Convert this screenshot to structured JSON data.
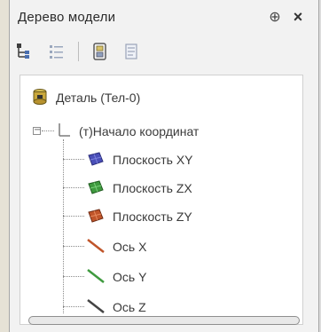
{
  "panel": {
    "title": "Дерево модели",
    "pin_glyph": "⊕",
    "close_glyph": "×"
  },
  "toolbar": {
    "buttons": [
      {
        "name": "build-tree-icon"
      },
      {
        "name": "list-view-icon"
      },
      {
        "name": "filter-icon"
      },
      {
        "name": "properties-icon"
      }
    ]
  },
  "tree": {
    "root": {
      "label": "Деталь (Тел-0)",
      "icon": "part-icon"
    },
    "origin": {
      "label": "(т)Начало координат",
      "icon": "axes-origin-icon",
      "expander": "−"
    },
    "items": [
      {
        "label": "Плоскость XY",
        "icon": "plane-xy-icon",
        "color": "#4a4fb8"
      },
      {
        "label": "Плоскость ZX",
        "icon": "plane-zx-icon",
        "color": "#3f9a3f"
      },
      {
        "label": "Плоскость ZY",
        "icon": "plane-zy-icon",
        "color": "#c0552a"
      },
      {
        "label": "Ось X",
        "icon": "axis-x-icon",
        "color": "#c0552a"
      },
      {
        "label": "Ось Y",
        "icon": "axis-y-icon",
        "color": "#3f9a3f"
      },
      {
        "label": "Ось Z",
        "icon": "axis-z-icon",
        "color": "#444444"
      }
    ]
  }
}
